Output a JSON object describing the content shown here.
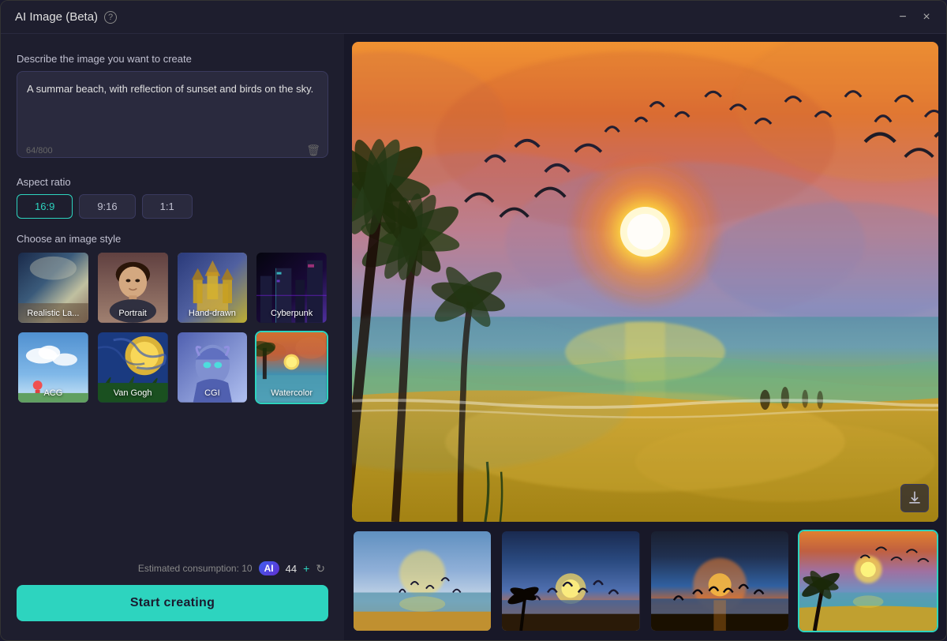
{
  "window": {
    "title": "AI Image (Beta)",
    "help_tooltip": "Help",
    "minimize_icon": "−",
    "close_icon": "×"
  },
  "left_panel": {
    "prompt_label": "Describe the image you want to create",
    "prompt_value": "A summar beach, with reflection of sunset and birds on the sky.",
    "prompt_counter": "64/800",
    "aspect_ratio": {
      "label": "Aspect ratio",
      "options": [
        "16:9",
        "9:16",
        "1:1"
      ],
      "selected": "16:9"
    },
    "style_label": "Choose an image style",
    "styles": [
      {
        "id": "realistic",
        "label": "Realistic La...",
        "css_class": "style-realistic"
      },
      {
        "id": "portrait",
        "label": "Portrait",
        "css_class": "style-portrait"
      },
      {
        "id": "handdrawn",
        "label": "Hand-drawn",
        "css_class": "style-handdrawn"
      },
      {
        "id": "cyberpunk",
        "label": "Cyberpunk",
        "css_class": "style-cyberpunk"
      },
      {
        "id": "acg",
        "label": "ACG",
        "css_class": "style-acg"
      },
      {
        "id": "vangogh",
        "label": "Van Gogh",
        "css_class": "style-vangogh"
      },
      {
        "id": "cgi",
        "label": "CGI",
        "css_class": "style-cgi"
      },
      {
        "id": "watercolor",
        "label": "Watercolor",
        "css_class": "style-watercolor",
        "active": true
      }
    ],
    "consumption_label": "Estimated consumption: 10",
    "ai_badge": "AI",
    "credits": "44",
    "start_button_label": "Start creating"
  },
  "right_panel": {
    "download_icon": "⬇",
    "thumbnails": [
      {
        "id": "thumb1",
        "css_class": "thumb1"
      },
      {
        "id": "thumb2",
        "css_class": "thumb2"
      },
      {
        "id": "thumb3",
        "css_class": "thumb3"
      },
      {
        "id": "thumb4",
        "css_class": "thumb4",
        "active": true
      }
    ]
  },
  "colors": {
    "accent": "#2dd4bf",
    "background": "#1e1e2e",
    "panel_bg": "#181828",
    "input_bg": "#2a2a3e",
    "border": "#3a3a5e",
    "text_primary": "#e0e0e0",
    "text_secondary": "#888"
  }
}
